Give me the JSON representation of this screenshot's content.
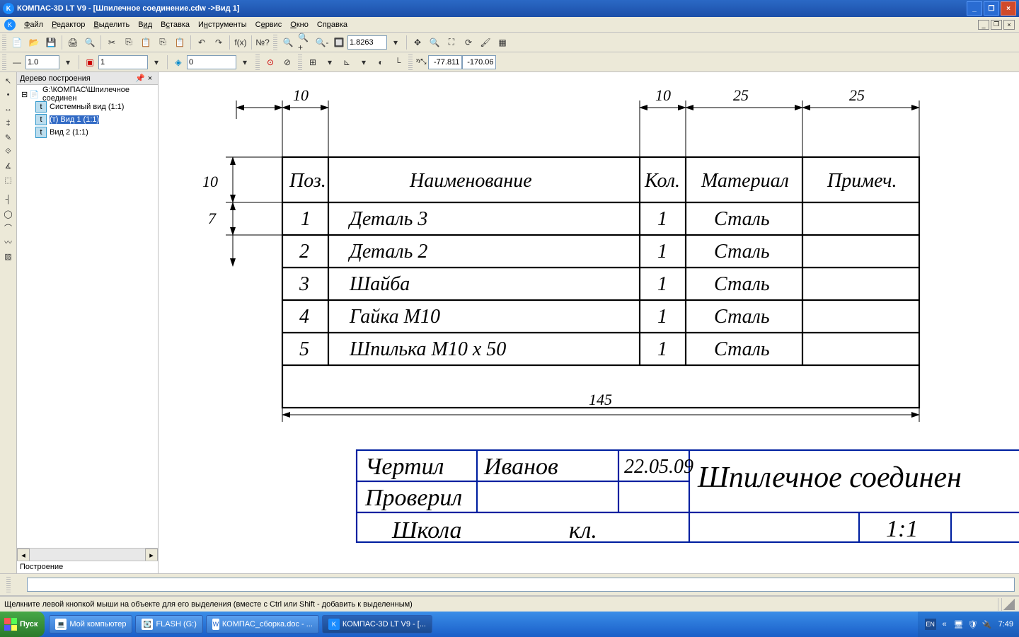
{
  "title": "КОМПАС-3D LT V9 - [Шпилечное соединение.cdw ->Вид 1]",
  "menu": [
    "Файл",
    "Редактор",
    "Выделить",
    "Вид",
    "Вставка",
    "Инструменты",
    "Сервис",
    "Окно",
    "Справка"
  ],
  "toolbar2": {
    "scale": "1.0",
    "layer": "1",
    "style": "0"
  },
  "zoombox": "1.8263",
  "coords": {
    "x": "-77.811",
    "y": "-170.06"
  },
  "panel": {
    "title": "Дерево построения",
    "root": "G:\\КОМПАС\\Шпилечное соединен",
    "items": [
      "Системный вид (1:1)",
      "(т) Вид 1 (1:1)",
      "Вид 2 (1:1)"
    ],
    "tab": "Построение"
  },
  "drawing": {
    "dim_left_top": "10",
    "dim_right_1": "10",
    "dim_right_2": "25",
    "dim_right_3": "25",
    "dim_v_top": "10",
    "dim_v_bot": "7",
    "dim_total": "145",
    "headers": [
      "Поз.",
      "Наименование",
      "Кол.",
      "Материал",
      "Примеч."
    ],
    "rows": [
      {
        "pos": "1",
        "name": "Деталь 3",
        "qty": "1",
        "mat": "Сталь",
        "note": ""
      },
      {
        "pos": "2",
        "name": "Деталь 2",
        "qty": "1",
        "mat": "Сталь",
        "note": ""
      },
      {
        "pos": "3",
        "name": "Шайба",
        "qty": "1",
        "mat": "Сталь",
        "note": ""
      },
      {
        "pos": "4",
        "name": "Гайка М10",
        "qty": "1",
        "mat": "Сталь",
        "note": ""
      },
      {
        "pos": "5",
        "name": "Шпилька М10 х 50",
        "qty": "1",
        "mat": "Сталь",
        "note": ""
      }
    ],
    "stamp": {
      "drew_lbl": "Чертил",
      "drew_name": "Иванов",
      "drew_date": "22.05.09",
      "check_lbl": "Проверил",
      "school": "Школа",
      "class": "кл.",
      "title": "Шпилечное соединен",
      "scale": "1:1"
    }
  },
  "status": "Щелкните левой кнопкой мыши на объекте для его выделения (вместе с Ctrl или Shift - добавить к выделенным)",
  "taskbar": {
    "start": "Пуск",
    "items": [
      "Мой компьютер",
      "FLASH (G:)",
      "КОМПАС_сборка.doc - ...",
      "КОМПАС-3D LT V9 - [..."
    ],
    "lang": "EN",
    "chev": "«",
    "time": "7:49"
  }
}
